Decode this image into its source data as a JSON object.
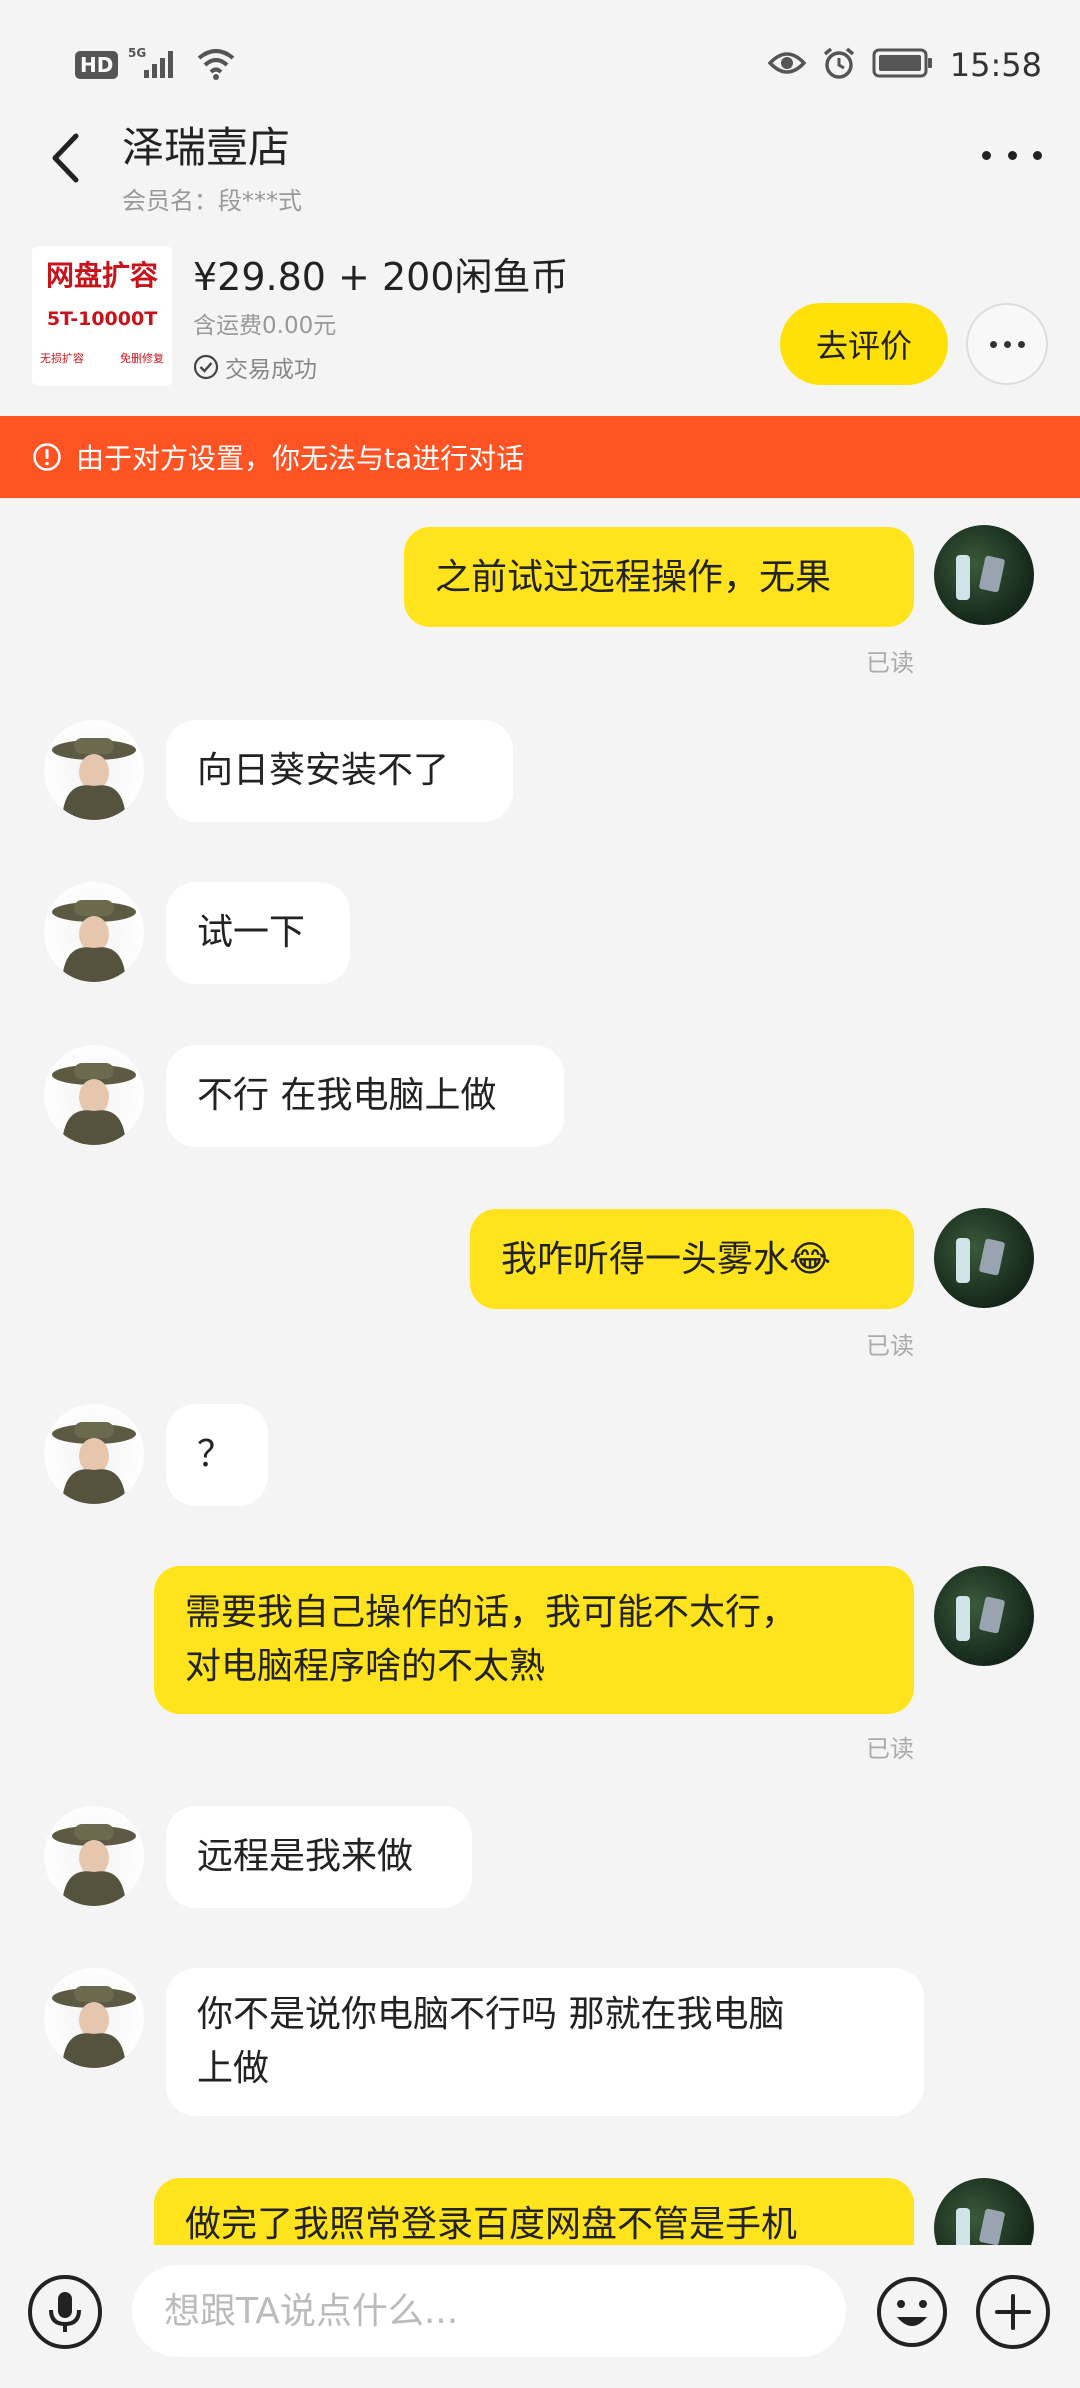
{
  "status_bar": {
    "hd": "HD",
    "network": "5G",
    "time": "15:58",
    "icons": [
      "signal-icon",
      "wifi-icon",
      "eye-icon",
      "alarm-icon",
      "battery-icon"
    ]
  },
  "header": {
    "title": "泽瑞壹店",
    "member_label": "会员名：段***式"
  },
  "product": {
    "thumb_title": "网盘扩容",
    "thumb_sub": "5T-10000T",
    "thumb_left": "无损扩容",
    "thumb_right": "免删修复",
    "price": "¥29.80 + 200闲鱼币",
    "shipping": "含运费0.00元",
    "status": "交易成功",
    "review_button": "去评价"
  },
  "banner": {
    "text": "由于对方设置，你无法与ta进行对话"
  },
  "messages": [
    {
      "from": "me",
      "text": "之前试过远程操作，无果",
      "read": "已读"
    },
    {
      "from": "them",
      "text": "向日葵安装不了"
    },
    {
      "from": "them",
      "text": "试一下"
    },
    {
      "from": "them",
      "text": "不行 在我电脑上做"
    },
    {
      "from": "me",
      "text": "我咋听得一头雾水😂",
      "read": "已读"
    },
    {
      "from": "them",
      "text": "？"
    },
    {
      "from": "me",
      "text": "需要我自己操作的话，我可能不太行，\n对电脑程序啥的不太熟",
      "read": "已读"
    },
    {
      "from": "them",
      "text": "远程是我来做"
    },
    {
      "from": "them",
      "text": "你不是说你电脑不行吗 那就在我电脑\n上做"
    },
    {
      "from": "me",
      "text": "做完了我照常登录百度网盘不管是手机"
    }
  ],
  "input": {
    "placeholder": "想跟TA说点什么..."
  },
  "colors": {
    "accent_yellow": "#ffe41d",
    "banner_orange": "#ff5323",
    "background": "#f4f4f4"
  }
}
